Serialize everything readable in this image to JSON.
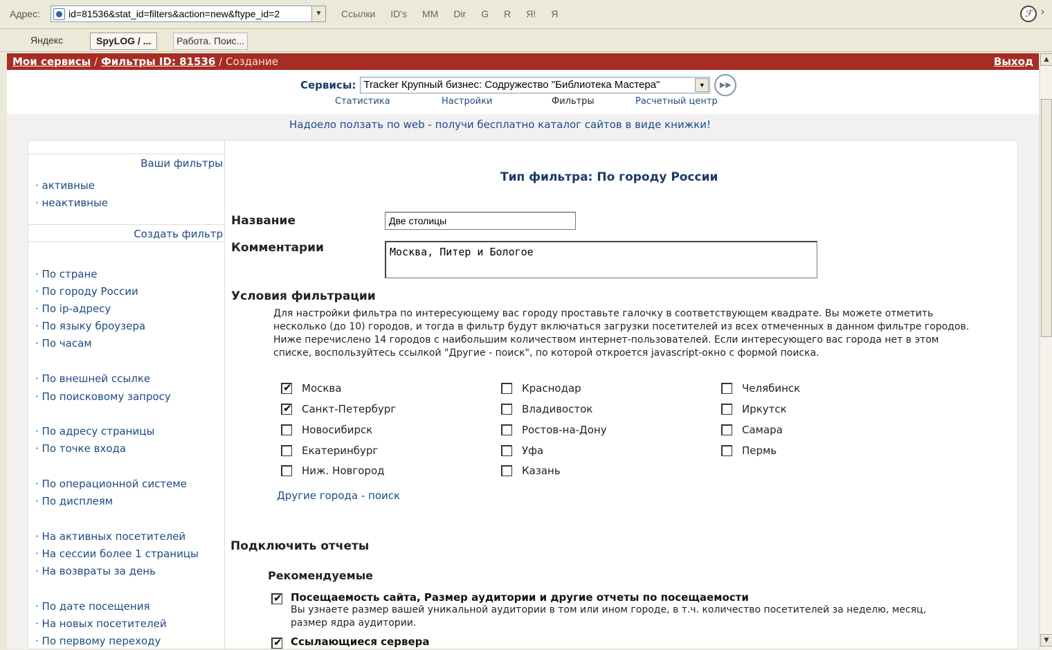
{
  "browser": {
    "address_label": "Адрес:",
    "url": "id=81536&stat_id=filters&action=new&ftype_id=2",
    "links": [
      "Ссылки",
      "ID's",
      "MM",
      "Dir",
      "G",
      "R",
      "Я!",
      "Я"
    ],
    "tabs": [
      {
        "label": "Яндекс",
        "active": false
      },
      {
        "label": "SpyLOG / ...",
        "active": true
      },
      {
        "label": "Работа. Поис...",
        "active": false
      }
    ]
  },
  "header": {
    "crumb1": "Мои сервисы",
    "crumb2": "Фильтры ID: 81536",
    "crumb3": "Создание",
    "logout": "Выход"
  },
  "services": {
    "label": "Сервисы:",
    "selected": "Tracker Крупный бизнес: Содружество \"Библиотека Мастера\"",
    "nav": [
      "Статистика",
      "Настройки",
      "Фильтры",
      "Расчетный центр"
    ]
  },
  "promo": "Надоело ползать по web - получи бесплатно каталог сайтов в виде книжки!",
  "sidebar": {
    "your_filters": "Ваши фильтры",
    "status_items": [
      "активные",
      "неактивные"
    ],
    "create_filter": "Создать фильтр",
    "groups": [
      [
        "По стране",
        "По городу России",
        "По ip-адресу",
        "По языку броузера",
        "По часам"
      ],
      [
        "По внешней ссылке",
        "По поисковому запросу"
      ],
      [
        "По адресу страницы",
        "По точке входа"
      ],
      [
        "По операционной системе",
        "По дисплеям"
      ],
      [
        "На активных посетителей",
        "На сессии более 1 страницы",
        "На возвраты за день"
      ],
      [
        "По дате посещения",
        "На новых посетителей",
        "По первому переходу"
      ]
    ]
  },
  "form": {
    "filter_type": "Тип фильтра: По городу России",
    "name_label": "Название",
    "name_value": "Две столицы",
    "comment_label": "Комментарии",
    "comment_value": "Москва, Питер и Бологое",
    "conditions_title": "Условия фильтрации",
    "conditions_text": "Для настройки фильтра по интересующему вас городу проставьте галочку в соответствующем квадрате. Вы можете отметить несколько (до 10) городов, и тогда в фильтр будут включаться загрузки посетителей из всех отмеченных в данном фильтре городов. Ниже перечислено 14 городов с наибольшим количеством интернет-пользователей. Если интересующего вас города нет в этом списке, воспользуйтесь ссылкой \"Другие - поиск\", по которой откроется javascript-окно с формой поиска.",
    "cities": {
      "col1": [
        {
          "name": "Москва",
          "checked": true
        },
        {
          "name": "Санкт-Петербург",
          "checked": true
        },
        {
          "name": "Новосибирск",
          "checked": false
        },
        {
          "name": "Екатеринбург",
          "checked": false
        },
        {
          "name": "Ниж. Новгород",
          "checked": false
        }
      ],
      "col2": [
        {
          "name": "Краснодар",
          "checked": false
        },
        {
          "name": "Владивосток",
          "checked": false
        },
        {
          "name": "Ростов-на-Дону",
          "checked": false
        },
        {
          "name": "Уфа",
          "checked": false
        },
        {
          "name": "Казань",
          "checked": false
        }
      ],
      "col3": [
        {
          "name": "Челябинск",
          "checked": false
        },
        {
          "name": "Иркутск",
          "checked": false
        },
        {
          "name": "Самара",
          "checked": false
        },
        {
          "name": "Пермь",
          "checked": false
        }
      ]
    },
    "other_cities": "Другие города - поиск",
    "reports_title": "Подключить отчеты",
    "recommended_title": "Рекомендуемые",
    "reports": [
      {
        "checked": true,
        "title": "Посещаемость сайта, Размер аудитории и другие отчеты по посещаемости",
        "desc": "Вы узнаете размер вашей уникальной аудитории в том или ином городе, в т.ч. количество посетителей за неделю, месяц, размер ядра аудитории."
      },
      {
        "checked": true,
        "title": "Ссылающиеся сервера",
        "desc": ""
      }
    ]
  }
}
